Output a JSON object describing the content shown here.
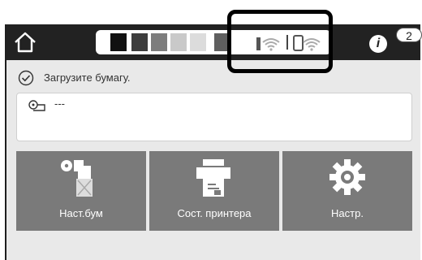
{
  "header": {
    "home_icon": "home-icon",
    "ink_colors": [
      "#111111",
      "#3d3d3d",
      "#7d7d7d",
      "#c9c9c9",
      "#dcdcdc",
      "#5f5f5f"
    ],
    "wifi_icons": [
      "wifi-icon",
      "wifi-direct-icon"
    ],
    "info_label": "i",
    "notification_count": "2"
  },
  "status": {
    "icon": "check-circle-icon",
    "message": "Загрузите бумагу."
  },
  "paper": {
    "icon": "roll-paper-icon",
    "value": "---"
  },
  "tiles": [
    {
      "label": "Наст.бум",
      "icon": "paper-settings-icon"
    },
    {
      "label": "Сост. принтера",
      "icon": "printer-status-icon"
    },
    {
      "label": "Настр.",
      "icon": "gear-icon"
    }
  ]
}
